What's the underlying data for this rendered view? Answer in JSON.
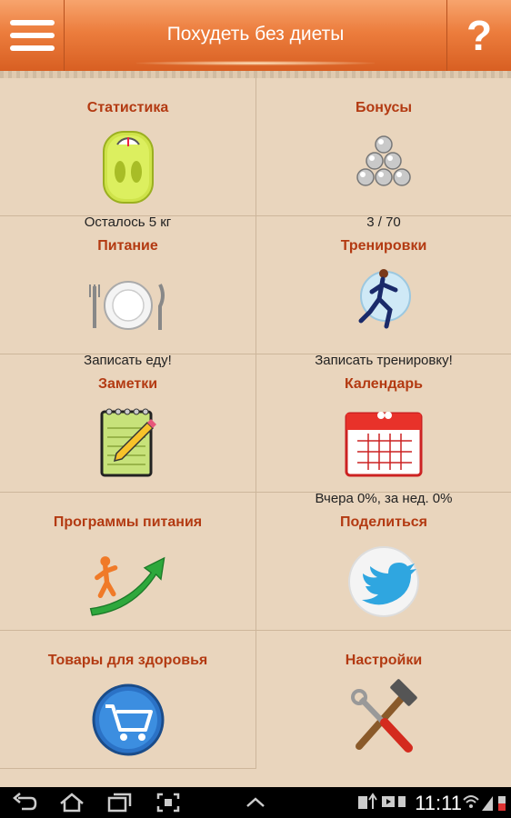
{
  "header": {
    "title": "Похудеть без диеты",
    "help_label": "?"
  },
  "tiles": [
    {
      "title": "Статистика",
      "subtitle": "Осталось 5 кг",
      "icon": "scale-icon"
    },
    {
      "title": "Бонусы",
      "subtitle": "3 / 70",
      "icon": "coins-pyramid-icon"
    },
    {
      "title": "Питание",
      "subtitle": "Записать еду!",
      "icon": "plate-icon"
    },
    {
      "title": "Тренировки",
      "subtitle": "Записать тренировку!",
      "icon": "runner-icon"
    },
    {
      "title": "Заметки",
      "subtitle": "",
      "icon": "notepad-icon"
    },
    {
      "title": "Календарь",
      "subtitle": "Вчера 0%, за нед. 0%",
      "icon": "calendar-icon"
    },
    {
      "title": "Программы питания",
      "subtitle": "",
      "icon": "growth-arrow-icon"
    },
    {
      "title": "Поделиться",
      "subtitle": "",
      "icon": "twitter-icon"
    },
    {
      "title": "Товары для здоровья",
      "subtitle": "",
      "icon": "shopping-cart-icon"
    },
    {
      "title": "Настройки",
      "subtitle": "",
      "icon": "tools-icon"
    }
  ],
  "statusbar": {
    "time": "11:11"
  },
  "colors": {
    "header": "#ec7d3d",
    "tile_title": "#b33a12",
    "background": "#e9d5bd"
  }
}
